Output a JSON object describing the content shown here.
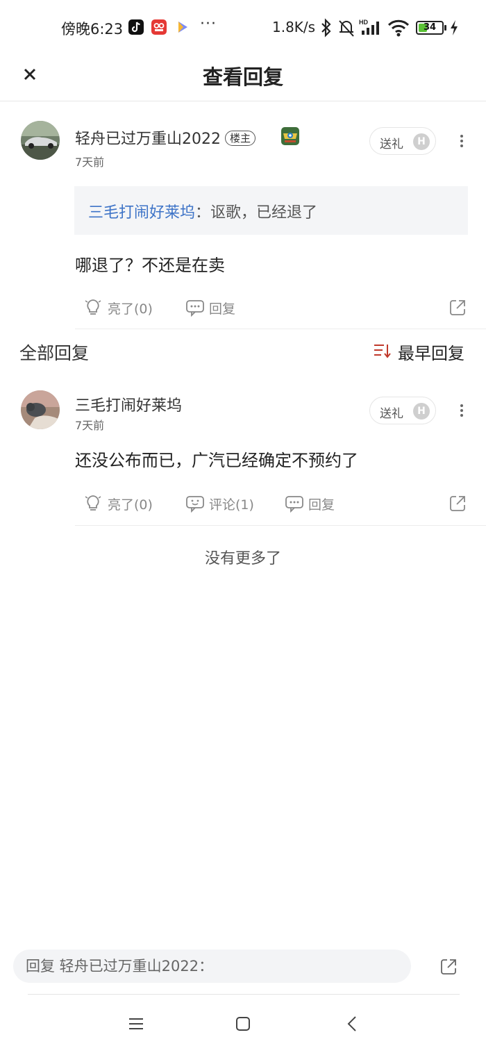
{
  "status_bar": {
    "time": "傍晚6:23",
    "dots": "···",
    "net_speed": "1.8K/s",
    "battery": "34"
  },
  "header": {
    "title": "查看回复"
  },
  "main_post": {
    "username": "轻舟已过万重山2022",
    "op_badge": "楼主",
    "time": "7天前",
    "gift_label": "送礼",
    "gift_coin": "H",
    "quote_author": "三毛打闹好莱坞",
    "quote_sep": "：",
    "quote_text": "讴歌，已经退了",
    "body": "哪退了？不还是在卖",
    "like_label": "亮了(0)",
    "reply_label": "回复"
  },
  "section": {
    "title": "全部回复",
    "sort_label": "最早回复"
  },
  "replies": [
    {
      "username": "三毛打闹好莱坞",
      "time": "7天前",
      "gift_label": "送礼",
      "gift_coin": "H",
      "body": "还没公布而已，广汽已经确定不预约了",
      "like_label": "亮了(0)",
      "comment_label": "评论(1)",
      "reply_label": "回复"
    }
  ],
  "footer": {
    "no_more": "没有更多了",
    "reply_placeholder": "回复 轻舟已过万重山2022："
  },
  "colors": {
    "link_blue": "#3d73c7",
    "sort_red": "#c0392b",
    "battery_green": "#5bc236"
  }
}
